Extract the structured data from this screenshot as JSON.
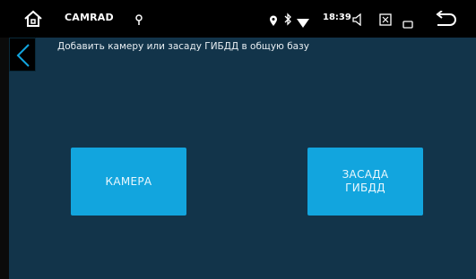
{
  "statusbar": {
    "app_title": "CAMRAD",
    "time": "18:39"
  },
  "header": {
    "title": "Добавить камеру или засаду ГИБДД в общую базу"
  },
  "buttons": {
    "camera_label": "КАМЕРА",
    "zasada_line1": "ЗАСАДА",
    "zasada_line2": "ГИБДД"
  },
  "colors": {
    "background": "#12344a",
    "button": "#12a5de",
    "statusbar": "#000000"
  },
  "icons": [
    "home-icon",
    "gps-icon",
    "location-icon",
    "bluetooth-icon",
    "wifi-icon",
    "volume-icon",
    "image-icon",
    "window-icon",
    "system-back-icon",
    "back-chevron-icon"
  ]
}
